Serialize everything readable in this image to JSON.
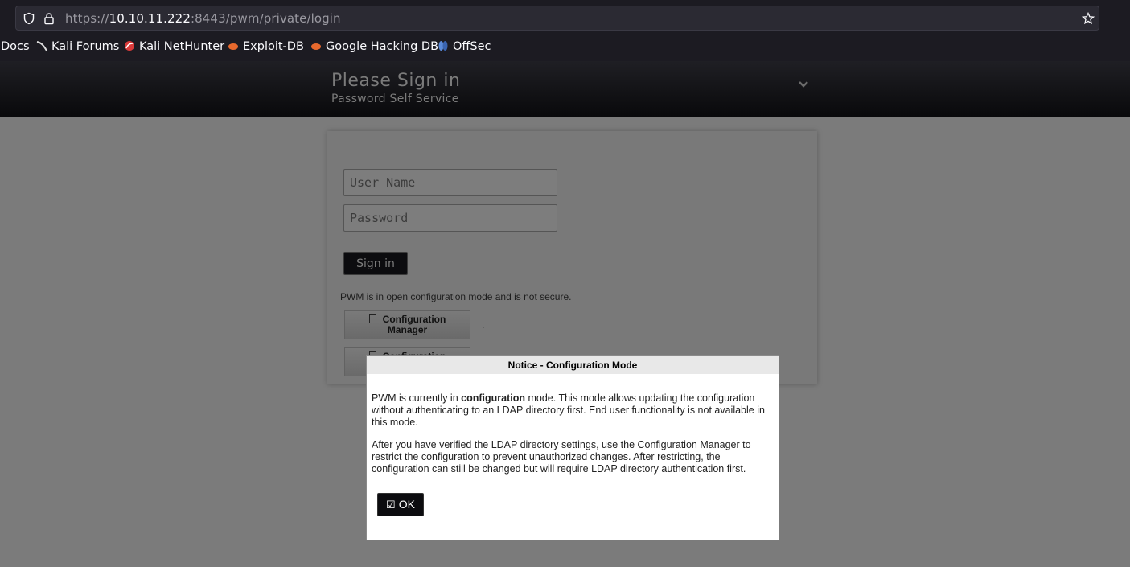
{
  "browser": {
    "url_prefix": "https://",
    "url_host": "10.10.11.222",
    "url_rest": ":8443/pwm/private/login",
    "bookmarks": [
      "Docs",
      "Kali Forums",
      "Kali NetHunter",
      "Exploit-DB",
      "Google Hacking DB",
      "OffSec"
    ]
  },
  "header": {
    "title": "Please Sign in",
    "subtitle": "Password Self Service"
  },
  "login": {
    "username_placeholder": "User Name",
    "password_placeholder": "Password",
    "signin_label": "Sign in",
    "open_config_notice": "PWM is in open configuration mode and is not secure.",
    "config_manager_label_1": "Configuration",
    "config_manager_label_2": "Manager",
    "config_editor_label": "Configuration",
    "dot": "."
  },
  "dialog": {
    "title": "Notice - Configuration Mode",
    "p1_before": "PWM is currently in ",
    "p1_bold": "configuration",
    "p1_after": " mode. This mode allows updating the configuration without authenticating to an LDAP directory first. End user functionality is not available in this mode.",
    "p2": "After you have verified the LDAP directory settings, use the Configuration Manager to restrict the configuration to prevent unauthorized changes. After restricting, the configuration can still be changed but will require LDAP directory authentication first.",
    "ok_label": "OK"
  },
  "icons": [
    "shield-icon",
    "lock-icon",
    "star-icon",
    "chevron-down-icon",
    "document-icon",
    "checkbox-icon"
  ],
  "colors": {
    "header_bg": "#0d0d10",
    "overlay": "#7b7b7b",
    "button_dark": "#0c0c0f"
  }
}
